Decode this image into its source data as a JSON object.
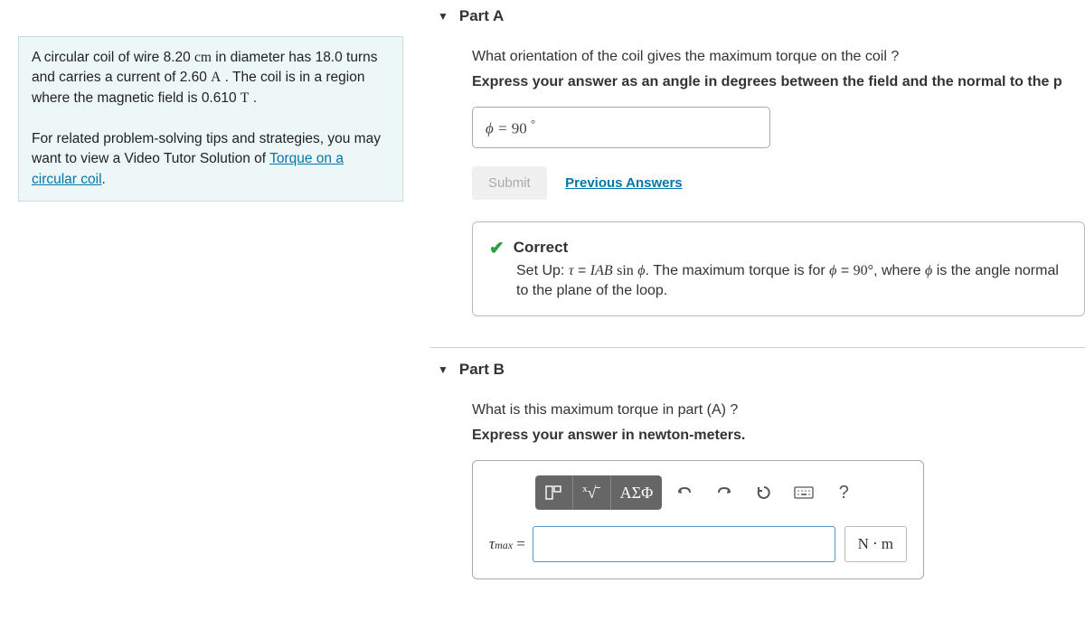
{
  "problem": {
    "text_html": "A circular coil of wire 8.20 <span class='unit'>cm</span> in diameter has 18.0 turns and carries a current of 2.60 <span class='unit'>A</span> . The coil is in a region where the magnetic field is 0.610 <span class='unit'>T</span> .",
    "related_intro": "For related problem-solving tips and strategies, you may want to view a Video Tutor Solution of ",
    "related_link": "Torque on a circular coil",
    "related_suffix": "."
  },
  "partA": {
    "title": "Part A",
    "question": "What orientation of the coil gives the maximum torque on the coil ?",
    "instruction": "Express your answer as an angle in degrees between the field and the normal to the p",
    "answer_prefix": "ϕ = ",
    "answer_value": "90",
    "answer_unit": "°",
    "submit": "Submit",
    "previous": "Previous Answers",
    "feedback_title": "Correct",
    "feedback_body_html": "Set Up: <span class='serif ital'>τ</span> = <span class='serif ital'>IAB</span> <span class='serif'>sin</span> <span class='serif ital'>ϕ</span>. The maximum torque is for <span class='serif ital'>ϕ</span> = <span class='serif'>90°</span>, where <span class='serif ital'>ϕ</span> is the angle normal to the plane of the loop."
  },
  "partB": {
    "title": "Part B",
    "question": "What is this maximum torque in part (A) ?",
    "instruction": "Express your answer in newton-meters.",
    "toolbar": {
      "greek": "ΑΣΦ",
      "help": "?"
    },
    "var_label_html": "<span class='ital'>τ<span class='sub'>max</span></span> = ",
    "unit": "N ⋅ m"
  }
}
